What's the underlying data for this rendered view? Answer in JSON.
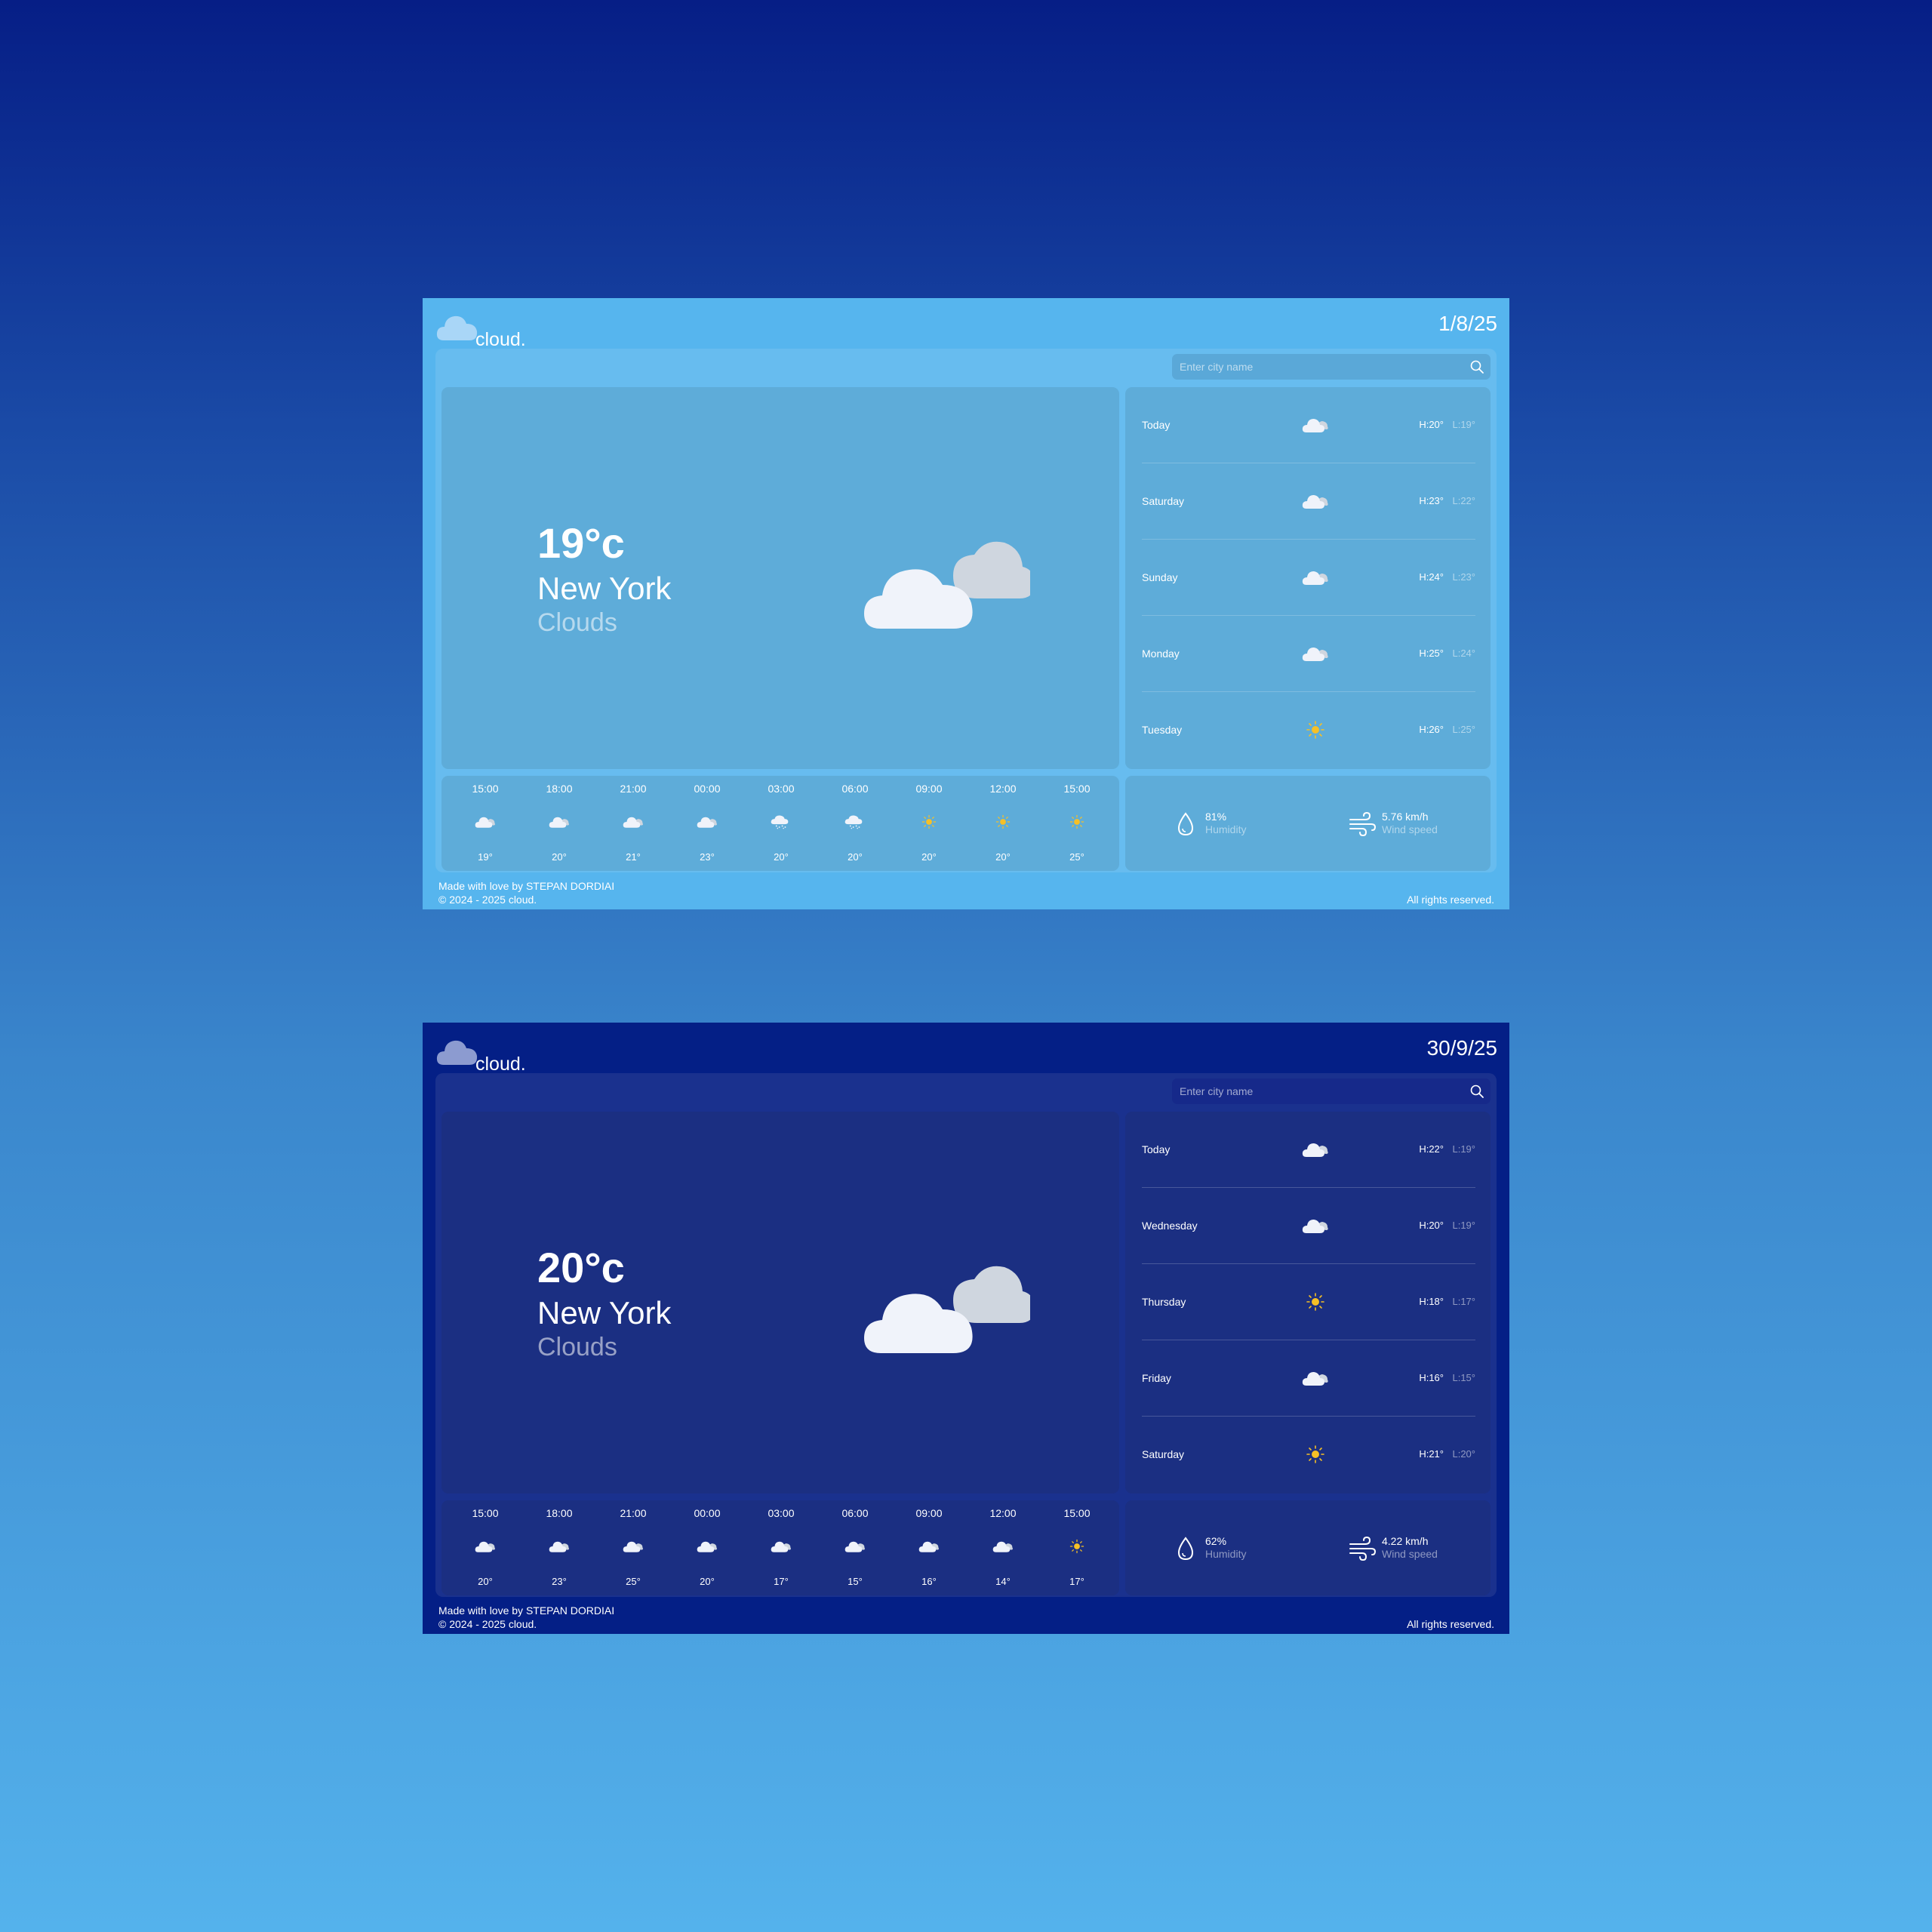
{
  "screens": [
    {
      "theme": "light",
      "app_name": "cloud.",
      "date": "1/8/25",
      "search": {
        "placeholder": "Enter city name"
      },
      "current": {
        "temp": "19°c",
        "city": "New York",
        "condition": "Clouds",
        "icon": "partly-cloudy-icon"
      },
      "forecast": [
        {
          "day": "Today",
          "icon": "cloud-icon",
          "high": "H:20°",
          "low": "L:19°"
        },
        {
          "day": "Saturday",
          "icon": "cloud-icon",
          "high": "H:23°",
          "low": "L:22°"
        },
        {
          "day": "Sunday",
          "icon": "cloud-icon",
          "high": "H:24°",
          "low": "L:23°"
        },
        {
          "day": "Monday",
          "icon": "cloud-icon",
          "high": "H:25°",
          "low": "L:24°"
        },
        {
          "day": "Tuesday",
          "icon": "sun-icon",
          "high": "H:26°",
          "low": "L:25°"
        }
      ],
      "hourly": [
        {
          "time": "15:00",
          "icon": "cloud-icon",
          "temp": "19°"
        },
        {
          "time": "18:00",
          "icon": "cloud-icon",
          "temp": "20°"
        },
        {
          "time": "21:00",
          "icon": "cloud-icon",
          "temp": "21°"
        },
        {
          "time": "00:00",
          "icon": "cloud-icon",
          "temp": "23°"
        },
        {
          "time": "03:00",
          "icon": "snow-icon",
          "temp": "20°"
        },
        {
          "time": "06:00",
          "icon": "snow-icon",
          "temp": "20°"
        },
        {
          "time": "09:00",
          "icon": "sun-icon",
          "temp": "20°"
        },
        {
          "time": "12:00",
          "icon": "sun-icon",
          "temp": "20°"
        },
        {
          "time": "15:00",
          "icon": "sun-icon",
          "temp": "25°"
        }
      ],
      "humidity": {
        "value": "81%",
        "label": "Humidity",
        "icon": "droplet-icon"
      },
      "wind": {
        "value": "5.76 km/h",
        "label": "Wind speed",
        "icon": "wind-icon"
      },
      "footer": {
        "made_by": "Made with love by STEPAN DORDIAI",
        "copyright": "© 2024 - 2025 cloud.",
        "rights": "All rights reserved."
      }
    },
    {
      "theme": "dark",
      "app_name": "cloud.",
      "date": "30/9/25",
      "search": {
        "placeholder": "Enter city name"
      },
      "current": {
        "temp": "20°c",
        "city": "New York",
        "condition": "Clouds",
        "icon": "partly-cloudy-icon"
      },
      "forecast": [
        {
          "day": "Today",
          "icon": "cloud-icon",
          "high": "H:22°",
          "low": "L:19°"
        },
        {
          "day": "Wednesday",
          "icon": "cloud-icon",
          "high": "H:20°",
          "low": "L:19°"
        },
        {
          "day": "Thursday",
          "icon": "sun-icon",
          "high": "H:18°",
          "low": "L:17°"
        },
        {
          "day": "Friday",
          "icon": "cloud-icon",
          "high": "H:16°",
          "low": "L:15°"
        },
        {
          "day": "Saturday",
          "icon": "sun-icon",
          "high": "H:21°",
          "low": "L:20°"
        }
      ],
      "hourly": [
        {
          "time": "15:00",
          "icon": "cloud-icon",
          "temp": "20°"
        },
        {
          "time": "18:00",
          "icon": "cloud-icon",
          "temp": "23°"
        },
        {
          "time": "21:00",
          "icon": "cloud-icon",
          "temp": "25°"
        },
        {
          "time": "00:00",
          "icon": "cloud-icon",
          "temp": "20°"
        },
        {
          "time": "03:00",
          "icon": "cloud-icon",
          "temp": "17°"
        },
        {
          "time": "06:00",
          "icon": "cloud-icon",
          "temp": "15°"
        },
        {
          "time": "09:00",
          "icon": "cloud-icon",
          "temp": "16°"
        },
        {
          "time": "12:00",
          "icon": "cloud-icon",
          "temp": "14°"
        },
        {
          "time": "15:00",
          "icon": "sun-icon",
          "temp": "17°"
        }
      ],
      "humidity": {
        "value": "62%",
        "label": "Humidity",
        "icon": "droplet-icon"
      },
      "wind": {
        "value": "4.22 km/h",
        "label": "Wind speed",
        "icon": "wind-icon"
      },
      "footer": {
        "made_by": "Made with love by STEPAN DORDIAI",
        "copyright": "© 2024 - 2025 cloud.",
        "rights": "All rights reserved."
      }
    }
  ],
  "colors": {
    "sun": "#f6c026",
    "cloud_front": "#f0f3fa",
    "cloud_back": "#cfd6df"
  }
}
